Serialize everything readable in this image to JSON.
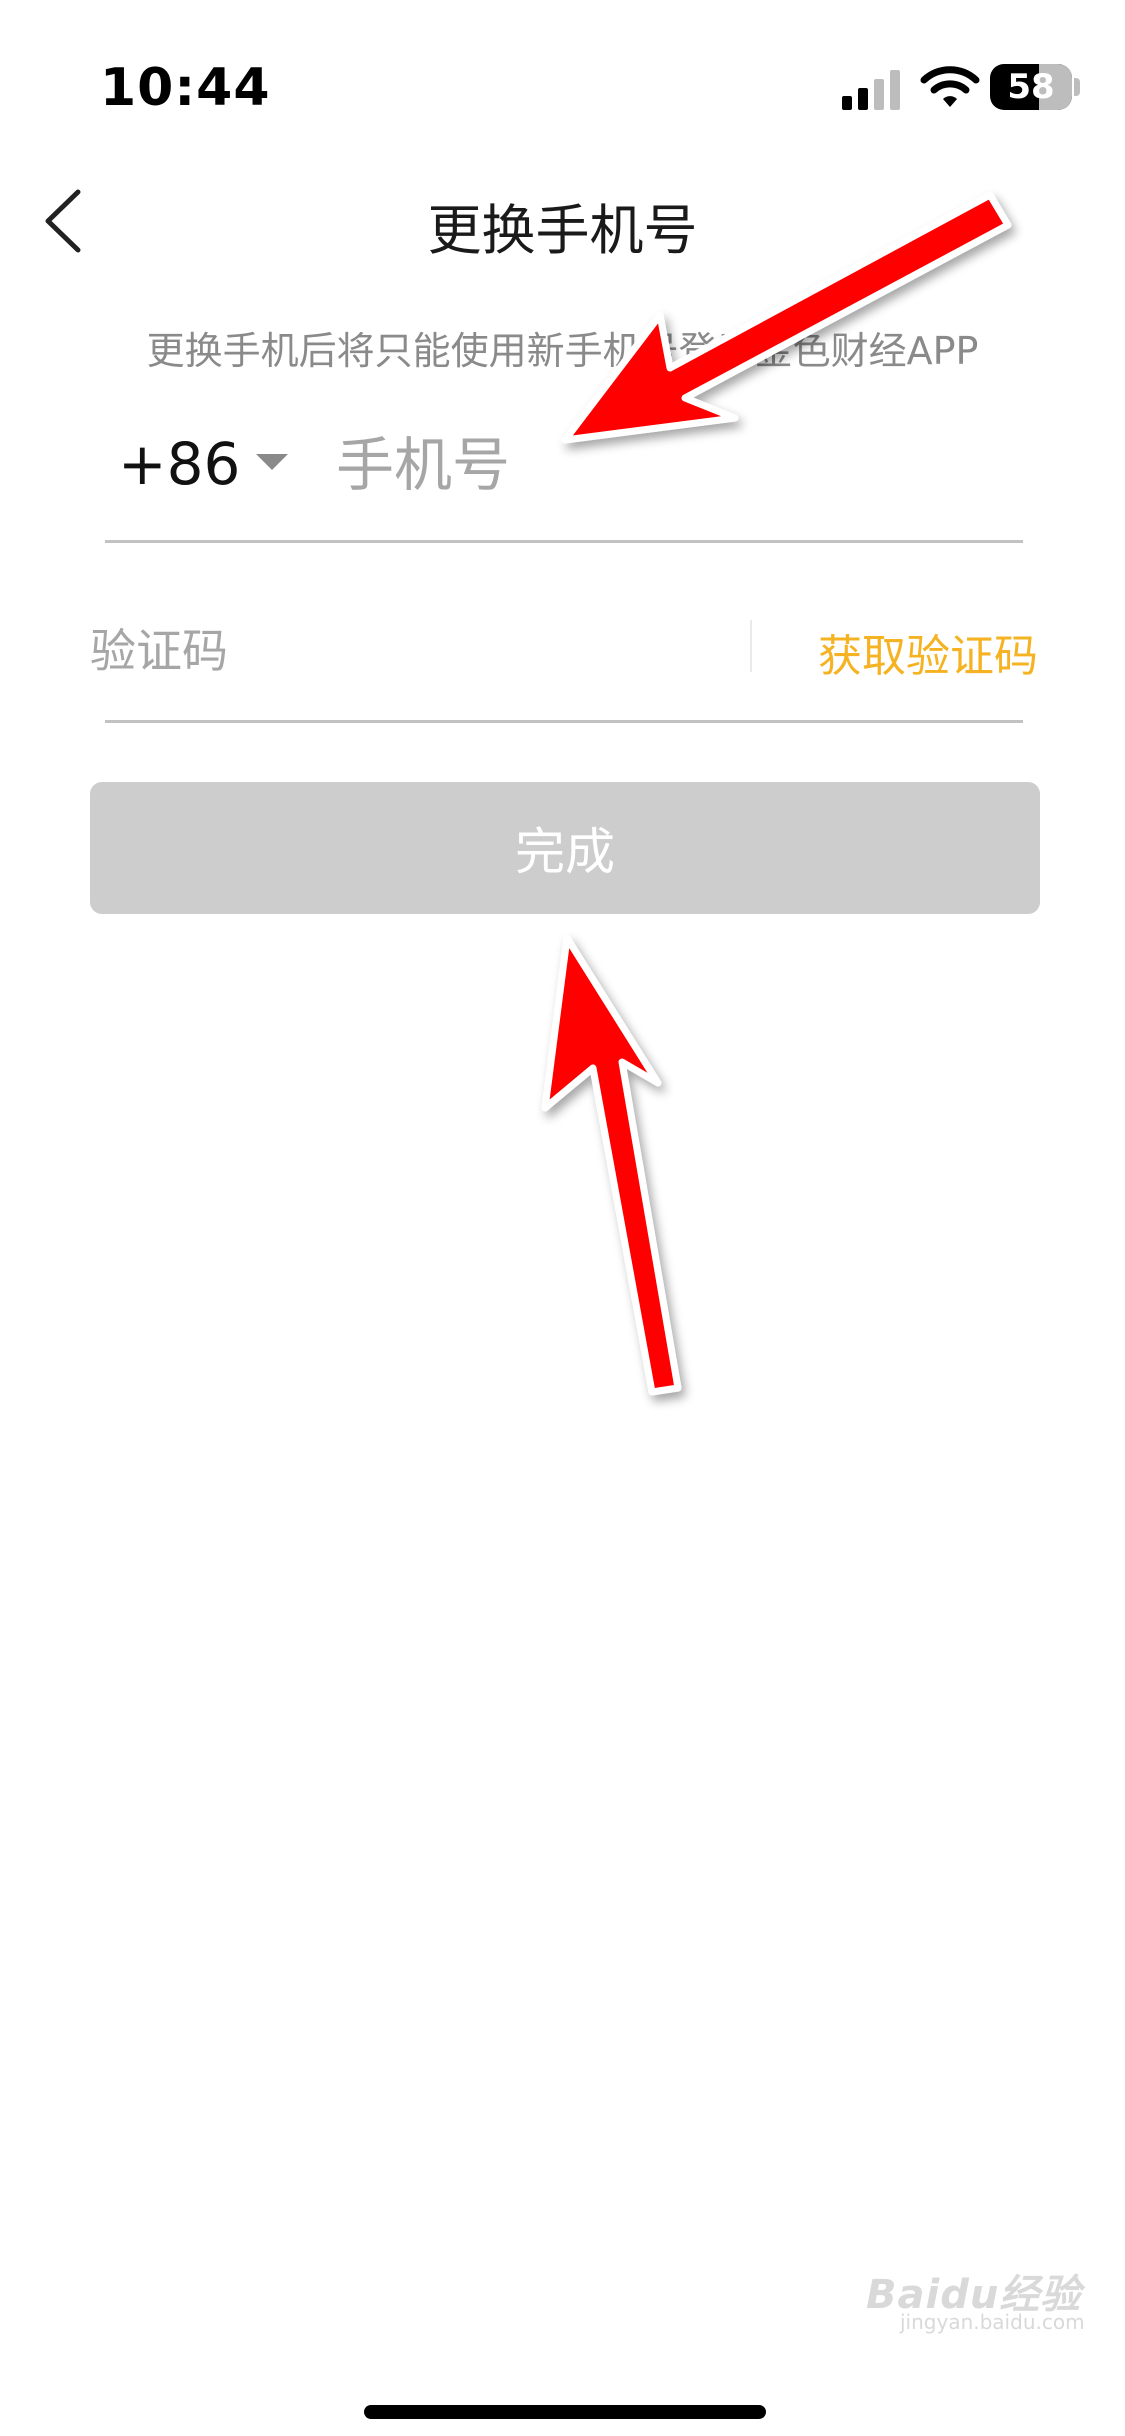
{
  "status_bar": {
    "time": "10:44",
    "battery_level": "58"
  },
  "header": {
    "title": "更换手机号"
  },
  "notice": "更换手机后将只能使用新手机号登录金色财经APP",
  "phone_field": {
    "country_code": "+86",
    "placeholder": "手机号"
  },
  "code_field": {
    "placeholder": "验证码",
    "get_code_label": "获取验证码"
  },
  "finish_button": {
    "label": "完成"
  },
  "watermark": {
    "brand": "Baidu经验",
    "url": "jingyan.baidu.com"
  },
  "colors": {
    "accent": "#f5b323",
    "button_disabled": "#cdcdcd",
    "annotation_arrow": "#ff0000"
  }
}
